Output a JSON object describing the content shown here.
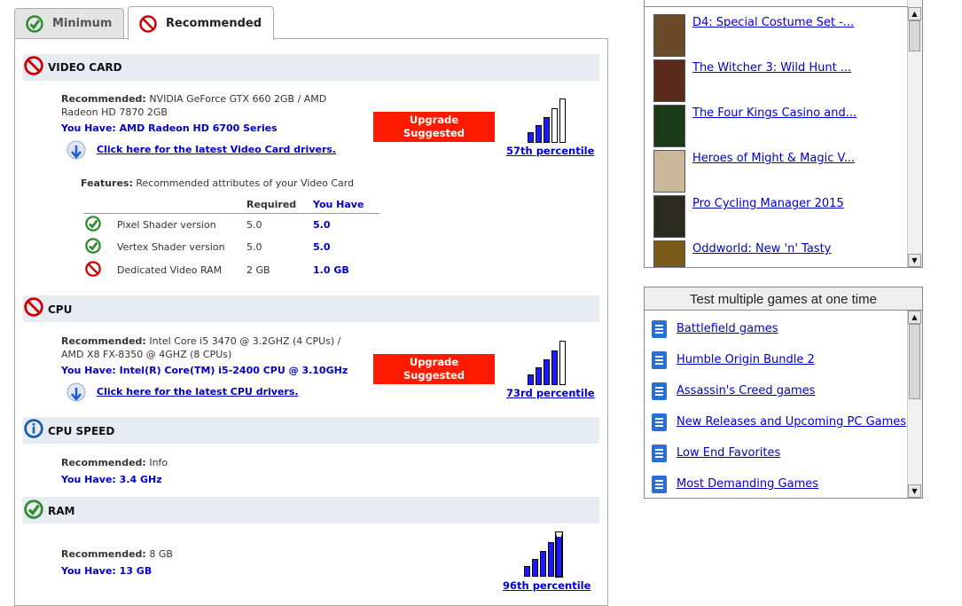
{
  "tabs": [
    {
      "label": "Minimum",
      "status": "pass"
    },
    {
      "label": "Recommended",
      "status": "fail"
    }
  ],
  "colors": {
    "pass": "#2e8b2e",
    "fail": "#cc0000",
    "info": "#1a5fa8",
    "bar_on": "#1a1aff",
    "upgrade": "#ff1a00",
    "link": "#0000cc"
  },
  "sections": {
    "video": {
      "title": "VIDEO CARD",
      "rec_label": "Recommended:",
      "rec_value_1": "NVIDIA GeForce GTX 660 2GB / AMD",
      "rec_value_2": "Radeon HD 7870 2GB",
      "you_have": "You Have: AMD Radeon HD 6700 Series",
      "driver_link": "Click here for the latest Video Card drivers.",
      "upgrade_1": "Upgrade",
      "upgrade_2": "Suggested",
      "percentile": "57th percentile",
      "percentile_value": 57,
      "features": {
        "label": "Features:",
        "desc": "Recommended attributes of your Video Card",
        "col_required": "Required",
        "col_you_have": "You Have",
        "rows": [
          {
            "name": "Pixel Shader version",
            "required": "5.0",
            "have": "5.0",
            "status": "pass"
          },
          {
            "name": "Vertex Shader version",
            "required": "5.0",
            "have": "5.0",
            "status": "pass"
          },
          {
            "name": "Dedicated Video RAM",
            "required": "2 GB",
            "have": "1.0 GB",
            "status": "fail"
          }
        ]
      }
    },
    "cpu": {
      "title": "CPU",
      "rec_label": "Recommended:",
      "rec_value_1": "Intel Core i5 3470 @ 3.2GHZ (4 CPUs) /",
      "rec_value_2": "AMD X8 FX-8350 @ 4GHZ (8 CPUs)",
      "you_have": "You Have: Intel(R) Core(TM) i5-2400 CPU @ 3.10GHz",
      "driver_link": "Click here for the latest CPU drivers.",
      "upgrade_1": "Upgrade",
      "upgrade_2": "Suggested",
      "percentile": "73rd percentile",
      "percentile_value": 73
    },
    "speed": {
      "title": "CPU SPEED",
      "rec_label": "Recommended:",
      "rec_value": "Info",
      "you_have": "You Have: 3.4 GHz"
    },
    "ram": {
      "title": "RAM",
      "rec_label": "Recommended:",
      "rec_value": "8 GB",
      "you_have": "You Have: 13 GB",
      "percentile": "96th percentile",
      "percentile_value": 96
    }
  },
  "games": [
    {
      "title": "D4: Special Costume Set -...",
      "thumb_color": "#6b4a2a"
    },
    {
      "title": "The Witcher 3: Wild Hunt ...",
      "thumb_color": "#5a2a1a"
    },
    {
      "title": "The Four Kings Casino and...",
      "thumb_color": "#1a3a1a"
    },
    {
      "title": "Heroes of Might & Magic V...",
      "thumb_color": "#c9b899"
    },
    {
      "title": "Pro Cycling Manager 2015",
      "thumb_color": "#2a2a20"
    },
    {
      "title": "Oddworld: New 'n' Tasty",
      "thumb_color": "#7a5a1a"
    }
  ],
  "multi": {
    "title": "Test multiple games at one time",
    "items": [
      "Battlefield games",
      "Humble Origin Bundle 2",
      "Assassin's Creed games",
      "New Releases and Upcoming PC Games",
      "Low End Favorites",
      "Most Demanding Games"
    ]
  }
}
